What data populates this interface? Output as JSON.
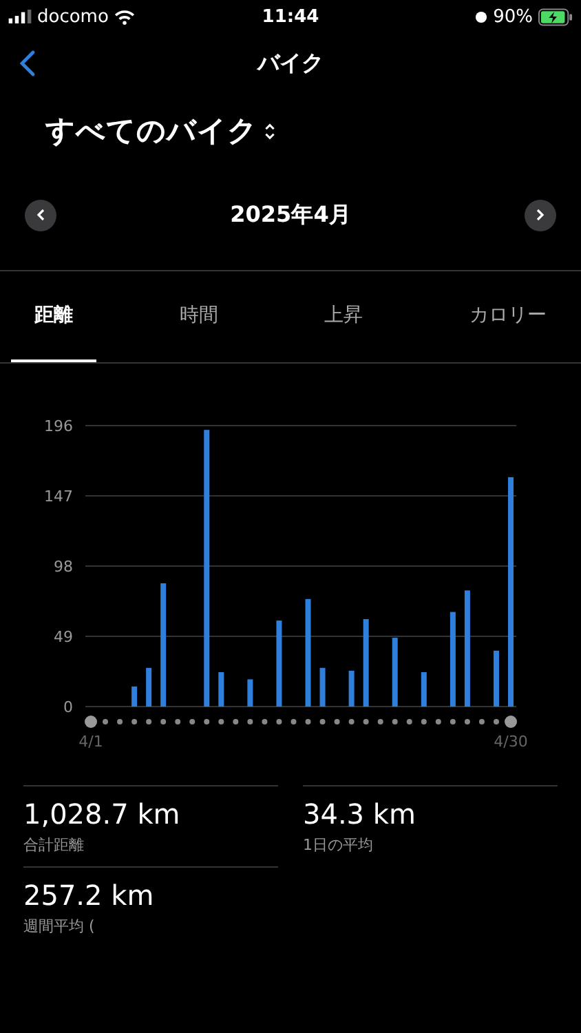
{
  "status_bar": {
    "carrier": "docomo",
    "time": "11:44",
    "battery": "90%"
  },
  "nav": {
    "title": "バイク"
  },
  "selector": {
    "label": "すべてのバイク"
  },
  "month": {
    "label": "2025年4月"
  },
  "tabs": [
    {
      "label": "距離",
      "selected": true
    },
    {
      "label": "時間",
      "selected": false
    },
    {
      "label": "上昇",
      "selected": false
    },
    {
      "label": "カロリー",
      "selected": false
    }
  ],
  "chart": {
    "chart_data": {
      "type": "bar",
      "categories": [
        "4/1",
        null,
        null,
        null,
        null,
        null,
        null,
        null,
        null,
        null,
        null,
        null,
        null,
        null,
        null,
        null,
        null,
        null,
        null,
        null,
        null,
        null,
        null,
        null,
        null,
        null,
        null,
        null,
        null,
        "4/30"
      ],
      "series": [
        {
          "color": "#2f7fdc",
          "values": [
            0,
            0,
            0,
            14,
            27,
            86,
            0,
            0,
            193,
            24,
            0,
            19,
            0,
            60,
            0,
            75,
            27,
            0,
            25,
            61,
            0,
            48,
            0,
            24,
            0,
            66,
            81,
            0,
            39,
            160
          ]
        }
      ],
      "ylim": [
        0,
        196
      ],
      "yticks": [
        0,
        49,
        98,
        147,
        196
      ],
      "grid": true
    }
  },
  "stats": [
    {
      "value": "1,028.7 km",
      "label": "合計距離"
    },
    {
      "value": "34.3 km",
      "label": "1日の平均"
    },
    {
      "value": "257.2 km",
      "label": "週間平均 ("
    }
  ]
}
